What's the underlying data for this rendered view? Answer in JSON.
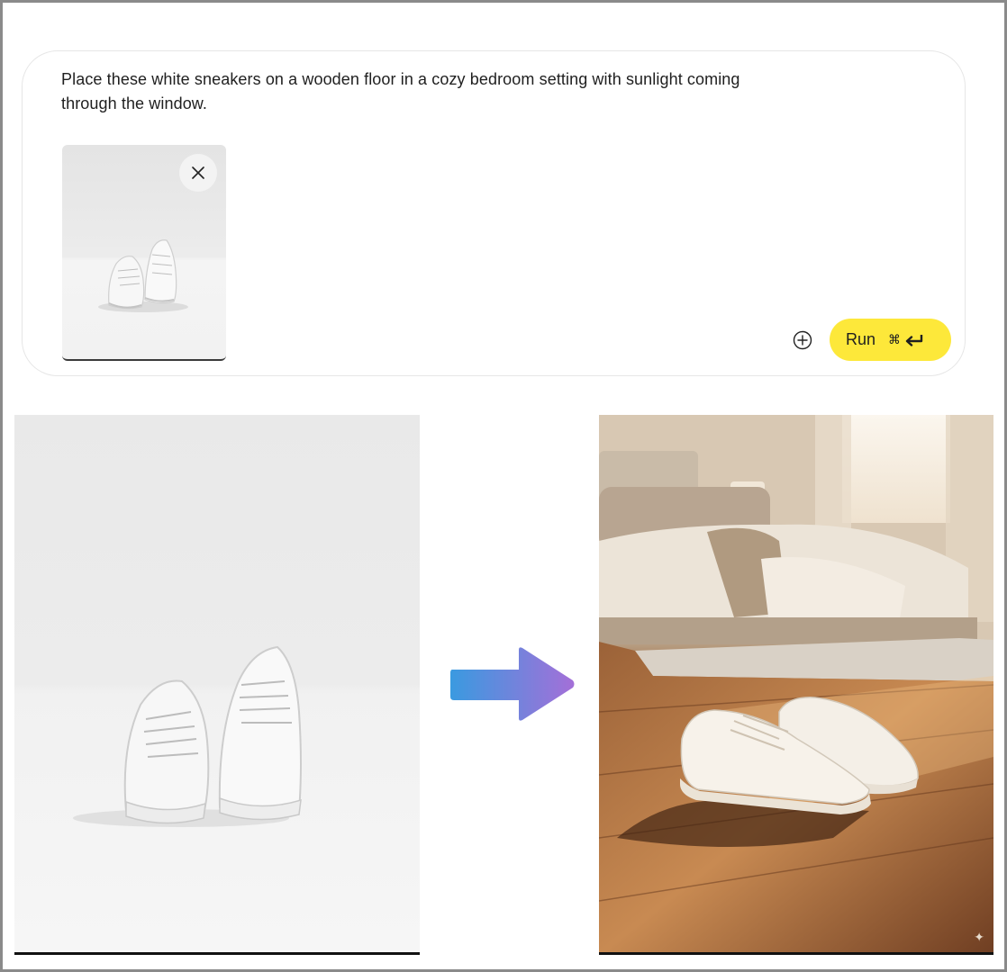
{
  "prompt": {
    "text": "Place these white sneakers on a wooden floor in a cozy bedroom setting with sunlight coming through the window."
  },
  "attachment": {
    "thumbnail_icon": "sneakers-thumbnail",
    "remove_icon": "close-icon"
  },
  "actions": {
    "add_icon": "plus-circle-icon",
    "run_label": "Run",
    "shortcut_cmd": "⌘",
    "shortcut_enter_icon": "enter-icon",
    "run_color": "#fde83a"
  },
  "result": {
    "input_image": "white-sneakers-studio",
    "arrow_icon": "gradient-right-arrow-icon",
    "arrow_colors": [
      "#3a9ae0",
      "#a46fd8"
    ],
    "output_image": "sneakers-bedroom-wooden-floor"
  }
}
